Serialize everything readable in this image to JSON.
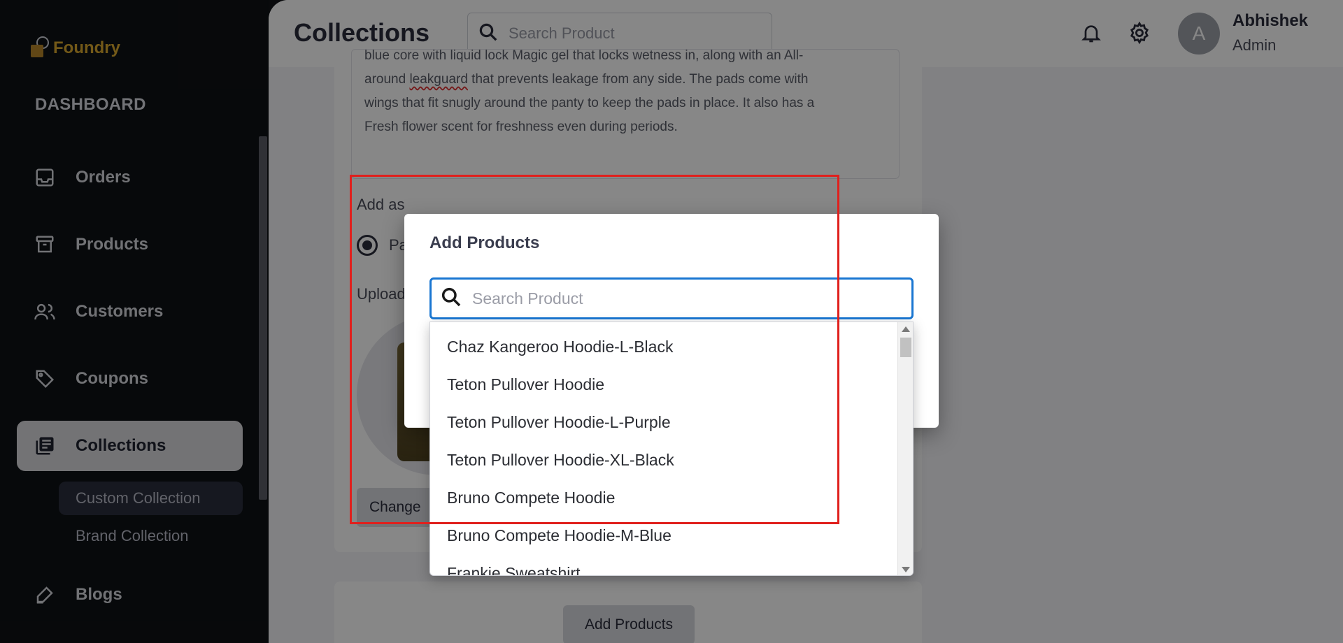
{
  "brand": {
    "name": "Foundry"
  },
  "sidebar": {
    "section_label": "DASHBOARD",
    "items": [
      {
        "label": "Orders",
        "icon": "inbox-icon"
      },
      {
        "label": "Products",
        "icon": "archive-icon"
      },
      {
        "label": "Customers",
        "icon": "users-icon"
      },
      {
        "label": "Coupons",
        "icon": "tag-icon"
      },
      {
        "label": "Collections",
        "icon": "collections-icon",
        "active": true
      },
      {
        "label": "Blogs",
        "icon": "edit-icon"
      }
    ],
    "sub_items": [
      {
        "label": "Custom Collection",
        "active": true
      },
      {
        "label": "Brand Collection"
      }
    ]
  },
  "header": {
    "title": "Collections",
    "search_placeholder": "Search Product",
    "user_initial": "A",
    "user_name": "Abhishek",
    "user_role": "Admin"
  },
  "form": {
    "description_lines": [
      "blue core with liquid lock Magic gel that locks wetness in, along with an All-",
      "around leakguard that prevents leakage from any side. The pads come with",
      "wings that fit snugly around the panty to keep the pads in place. It also has a",
      "Fresh flower scent for freshness even during periods."
    ],
    "description_line2_pre": "around ",
    "description_line2_word": "leakguard",
    "description_line2_post": " that prevents leakage from any side. The pads come with",
    "add_as_label": "Add as",
    "radio_label": "Pa",
    "upload_label": "Upload",
    "change_button": "Change",
    "add_products_button": "Add Products"
  },
  "dialog": {
    "title": "Add Products",
    "search_placeholder": "Search Product",
    "options": [
      "Chaz Kangeroo Hoodie-L-Black",
      "Teton Pullover Hoodie",
      "Teton Pullover Hoodie-L-Purple",
      "Teton Pullover Hoodie-XL-Black",
      "Bruno Compete Hoodie",
      "Bruno Compete Hoodie-M-Blue",
      "Frankie Sweatshirt"
    ]
  },
  "colors": {
    "sidebar_bg": "#0f1115",
    "brand_gold": "#d9a92f",
    "focus_blue": "#1976d2",
    "highlight_red": "#e0201d"
  }
}
